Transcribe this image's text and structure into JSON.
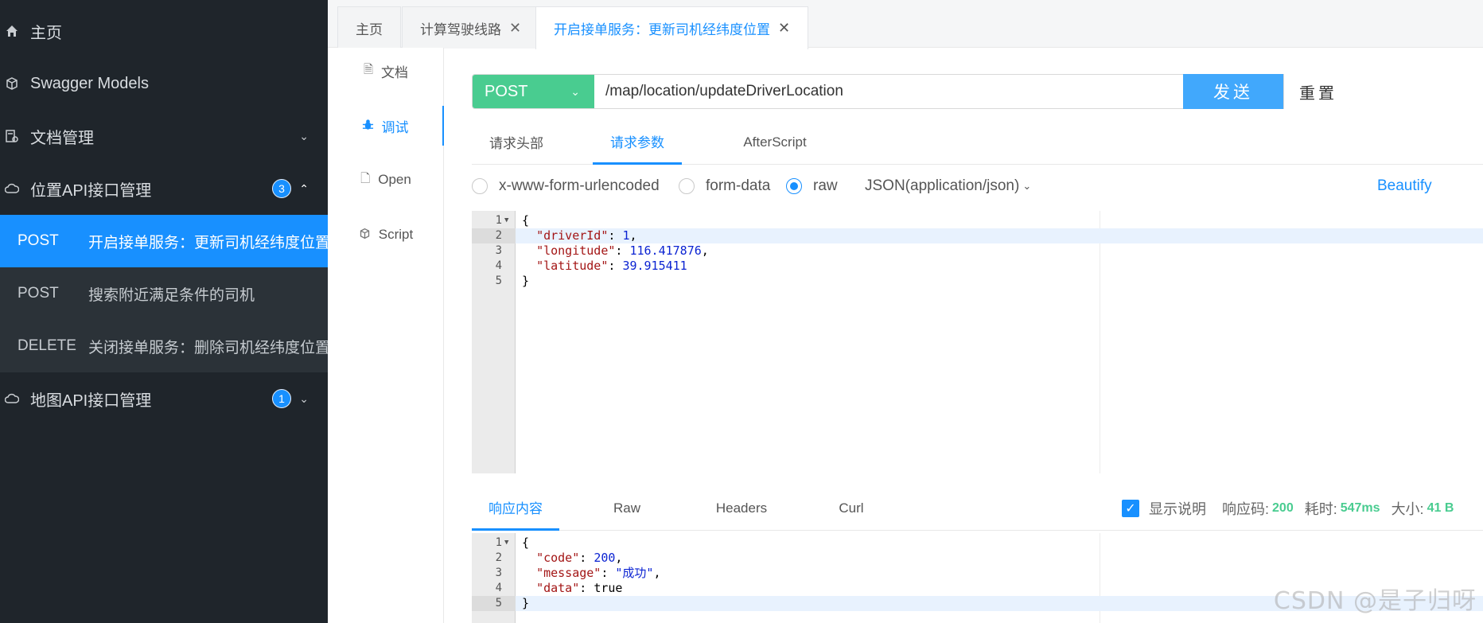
{
  "sidebar": {
    "items": [
      {
        "label": "主页",
        "icon": "home-icon"
      },
      {
        "label": "Swagger Models",
        "icon": "cube-icon"
      },
      {
        "label": "文档管理",
        "icon": "doc-settings-icon"
      },
      {
        "label": "位置API接口管理",
        "icon": "cloud-icon",
        "badge": "3"
      },
      {
        "label": "地图API接口管理",
        "icon": "cloud-icon",
        "badge": "1"
      }
    ],
    "sub_items": [
      {
        "method": "POST",
        "label": "开启接单服务：更新司机经纬度位置"
      },
      {
        "method": "POST",
        "label": "搜索附近满足条件的司机"
      },
      {
        "method": "DELETE",
        "label": "关闭接单服务：删除司机经纬度位置"
      }
    ]
  },
  "tabs": [
    {
      "label": "主页"
    },
    {
      "label": "计算驾驶线路"
    },
    {
      "label": "开启接单服务：更新司机经纬度位置"
    }
  ],
  "subnav": [
    {
      "label": "文档"
    },
    {
      "label": "调试"
    },
    {
      "label": "Open"
    },
    {
      "label": "Script"
    }
  ],
  "request": {
    "method": "POST",
    "url": "/map/location/updateDriverLocation",
    "send_label": "发送",
    "reset_label": "重置"
  },
  "param_tabs": [
    {
      "label": "请求头部"
    },
    {
      "label": "请求参数"
    },
    {
      "label": "AfterScript"
    }
  ],
  "body_types": {
    "options": [
      "x-www-form-urlencoded",
      "form-data",
      "raw"
    ],
    "selected": "raw",
    "content_type": "JSON(application/json)",
    "beautify_label": "Beautify"
  },
  "request_body": {
    "line_numbers": [
      "1",
      "2",
      "3",
      "4",
      "5"
    ],
    "driverId": "1",
    "longitude": "116.417876",
    "latitude": "39.915411"
  },
  "response_tabs": [
    {
      "label": "响应内容"
    },
    {
      "label": "Raw"
    },
    {
      "label": "Headers"
    },
    {
      "label": "Curl"
    }
  ],
  "response_meta": {
    "show_desc_label": "显示说明",
    "show_desc_checked": true,
    "code_label": "响应码:",
    "code_value": "200",
    "time_label": "耗时:",
    "time_value": "547ms",
    "size_label": "大小:",
    "size_value": "41 B"
  },
  "response_body": {
    "line_numbers": [
      "1",
      "2",
      "3",
      "4",
      "5"
    ],
    "code": "200",
    "message": "\"成功\"",
    "data": "true"
  },
  "watermark": "CSDN @是子归呀",
  "colors": {
    "sidebar_bg": "#1f252b",
    "accent": "#1890ff",
    "post_green": "#49cc90",
    "send_blue": "#41a8fc"
  }
}
